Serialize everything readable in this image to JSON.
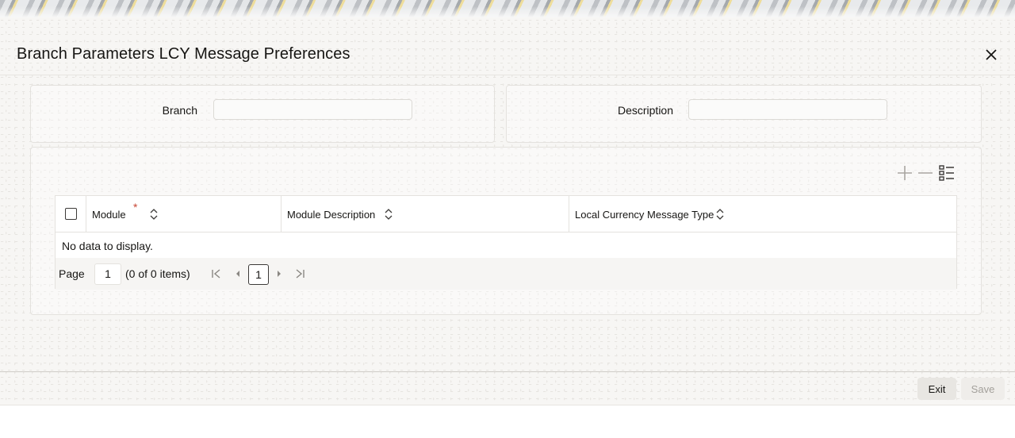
{
  "dialog": {
    "title": "Branch Parameters LCY Message Preferences"
  },
  "header_fields": {
    "branch_label": "Branch",
    "branch_value": "",
    "description_label": "Description",
    "description_value": ""
  },
  "grid": {
    "columns": [
      {
        "label": "Module",
        "required": true
      },
      {
        "label": "Module Description",
        "required": false
      },
      {
        "label": "Local Currency Message Type",
        "required": false
      }
    ],
    "required_marker": "*",
    "empty_message": "No data to display."
  },
  "pager": {
    "page_label": "Page",
    "current_page": "1",
    "items_summary": "(0 of 0 items)",
    "page_button": "1"
  },
  "footer": {
    "exit_label": "Exit",
    "save_label": "Save"
  },
  "icons": {
    "close": "close-icon",
    "add_row": "plus-icon",
    "delete_row": "minus-icon",
    "single_record_view": "list-view-icon",
    "sort": "sort-icon",
    "first": "first-page-icon",
    "previous": "previous-page-icon",
    "next": "next-page-icon",
    "last": "last-page-icon"
  },
  "colors": {
    "text": "#161513",
    "required": "#c74634",
    "disabled_text": "#a3a09b"
  }
}
